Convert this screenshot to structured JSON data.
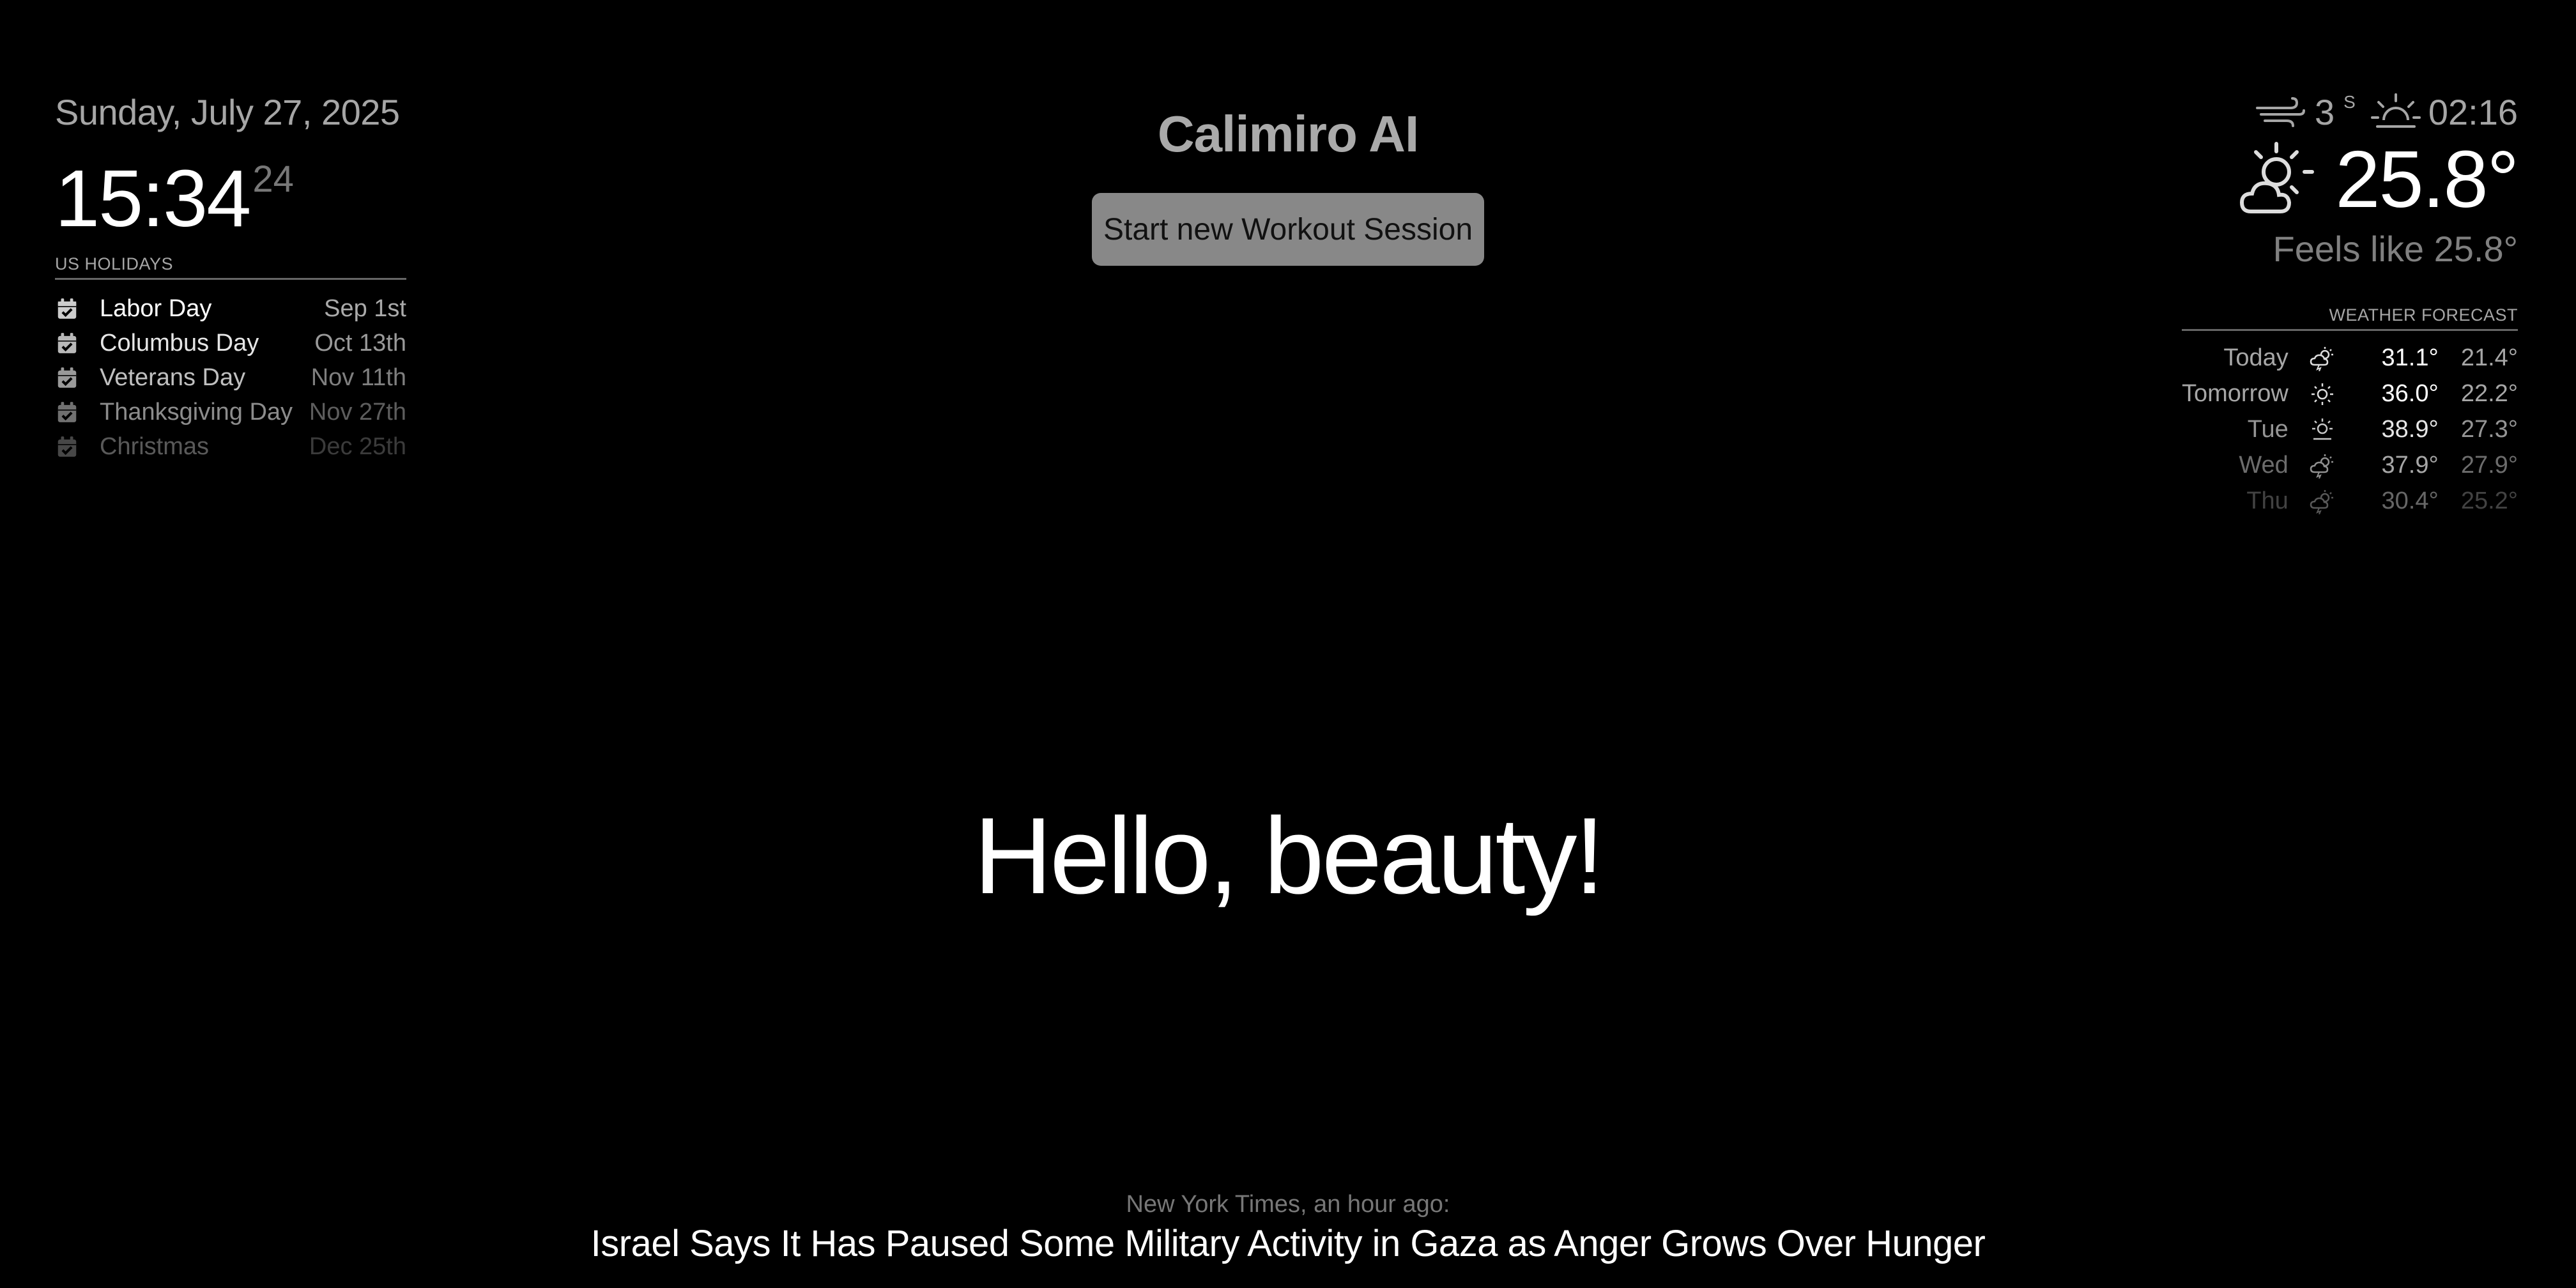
{
  "clock": {
    "date": "Sunday, July 27, 2025",
    "time_hm": "15:34",
    "time_sec": "24"
  },
  "holidays": {
    "header": "US HOLIDAYS",
    "icon": "calendar-check-icon",
    "items": [
      {
        "name": "Labor Day",
        "date": "Sep 1st"
      },
      {
        "name": "Columbus Day",
        "date": "Oct 13th"
      },
      {
        "name": "Veterans Day",
        "date": "Nov 11th"
      },
      {
        "name": "Thanksgiving Day",
        "date": "Nov 27th"
      },
      {
        "name": "Christmas",
        "date": "Dec 25th"
      }
    ]
  },
  "app": {
    "title": "Calimiro AI",
    "workout_button_label": "Start new Workout Session",
    "button_color": "#888888"
  },
  "compliment": {
    "text": "Hello, beauty!"
  },
  "current_weather": {
    "wind_icon": "wind-icon",
    "wind_speed": "3",
    "wind_direction": "S",
    "sun_icon": "sunrise-icon",
    "sun_time": "02:16",
    "condition_icon": "partly-cloudy-day-icon",
    "temperature": "25.8°",
    "feels_like": "Feels like 25.8°"
  },
  "forecast": {
    "header": "WEATHER FORECAST",
    "days": [
      {
        "day": "Today",
        "icon": "thunderstorm-day-icon",
        "max": "31.1°",
        "min": "21.4°"
      },
      {
        "day": "Tomorrow",
        "icon": "sunny-icon",
        "max": "36.0°",
        "min": "22.2°"
      },
      {
        "day": "Tue",
        "icon": "partly-sunny-icon",
        "max": "38.9°",
        "min": "27.3°"
      },
      {
        "day": "Wed",
        "icon": "thunderstorm-day-icon",
        "max": "37.9°",
        "min": "27.9°"
      },
      {
        "day": "Thu",
        "icon": "thunderstorm-day-icon",
        "max": "30.4°",
        "min": "25.2°"
      }
    ]
  },
  "news": {
    "source": "New York Times, an hour ago:",
    "headline": "Israel Says It Has Paused Some Military Activity in Gaza as Anger Grows Over Hunger"
  }
}
